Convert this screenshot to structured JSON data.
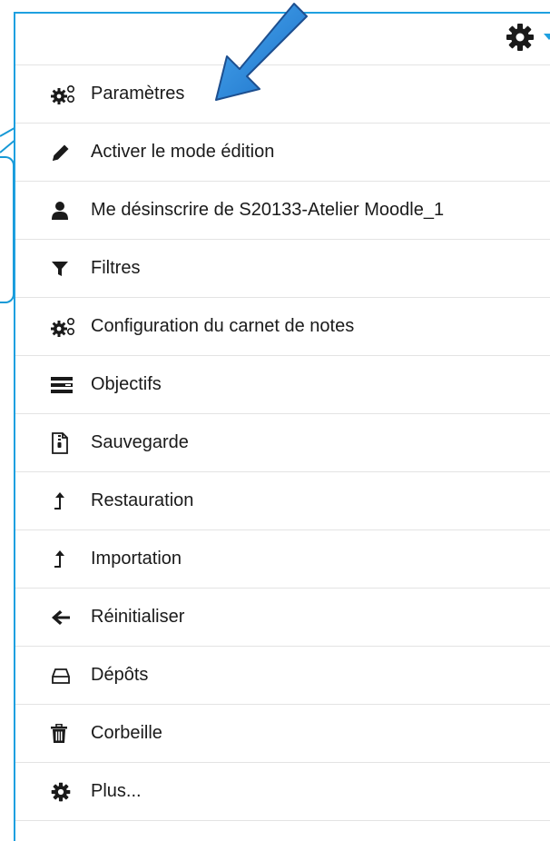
{
  "menu": {
    "items": [
      {
        "label": "Paramètres",
        "icon": "cogs-icon"
      },
      {
        "label": "Activer le mode édition",
        "icon": "pencil-icon"
      },
      {
        "label": "Me désinscrire de S20133-Atelier Moodle_1",
        "icon": "user-icon"
      },
      {
        "label": "Filtres",
        "icon": "filter-icon"
      },
      {
        "label": "Configuration du carnet de notes",
        "icon": "cogs-icon"
      },
      {
        "label": "Objectifs",
        "icon": "list-bars-icon"
      },
      {
        "label": "Sauvegarde",
        "icon": "file-zip-icon"
      },
      {
        "label": "Restauration",
        "icon": "level-up-icon"
      },
      {
        "label": "Importation",
        "icon": "level-up-icon"
      },
      {
        "label": "Réinitialiser",
        "icon": "arrow-left-icon"
      },
      {
        "label": "Dépôts",
        "icon": "hdd-icon"
      },
      {
        "label": "Corbeille",
        "icon": "trash-icon"
      },
      {
        "label": "Plus...",
        "icon": "cog-icon"
      }
    ]
  },
  "colors": {
    "accent": "#1ea0e0",
    "arrow": "#2f8ee0",
    "text": "#1a1a1a",
    "divider": "#e3e3e3"
  }
}
